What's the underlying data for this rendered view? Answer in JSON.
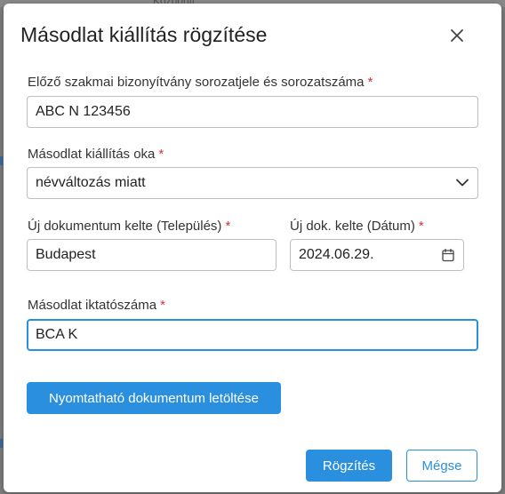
{
  "backdrop": {
    "partial_text": "Központi"
  },
  "dialog": {
    "title": "Másodlat kiállítás rögzítése",
    "close_icon": "close-icon"
  },
  "form": {
    "certificate_serial": {
      "label": "Előző szakmai bizonyítvány sorozatjele és sorozatszáma",
      "required_mark": "*",
      "value": "ABC N 123456"
    },
    "reason": {
      "label": "Másodlat kiállítás oka",
      "required_mark": "*",
      "selected": "névváltozás miatt",
      "icon": "chevron-down-icon"
    },
    "doc_place": {
      "label": "Új dokumentum kelte (Település)",
      "required_mark": "*",
      "value": "Budapest"
    },
    "doc_date": {
      "label": "Új dok. kelte (Dátum)",
      "required_mark": "*",
      "value": "2024.06.29.",
      "icon": "calendar-icon"
    },
    "file_number": {
      "label": "Másodlat iktatószáma",
      "required_mark": "*",
      "value": "BCA K"
    }
  },
  "actions": {
    "download_label": "Nyomtatható dokumentum letöltése",
    "save_label": "Rögzítés",
    "cancel_label": "Mégse"
  },
  "colors": {
    "primary": "#2b8fe0",
    "required": "#d0333a",
    "border": "#bfbfbf"
  }
}
